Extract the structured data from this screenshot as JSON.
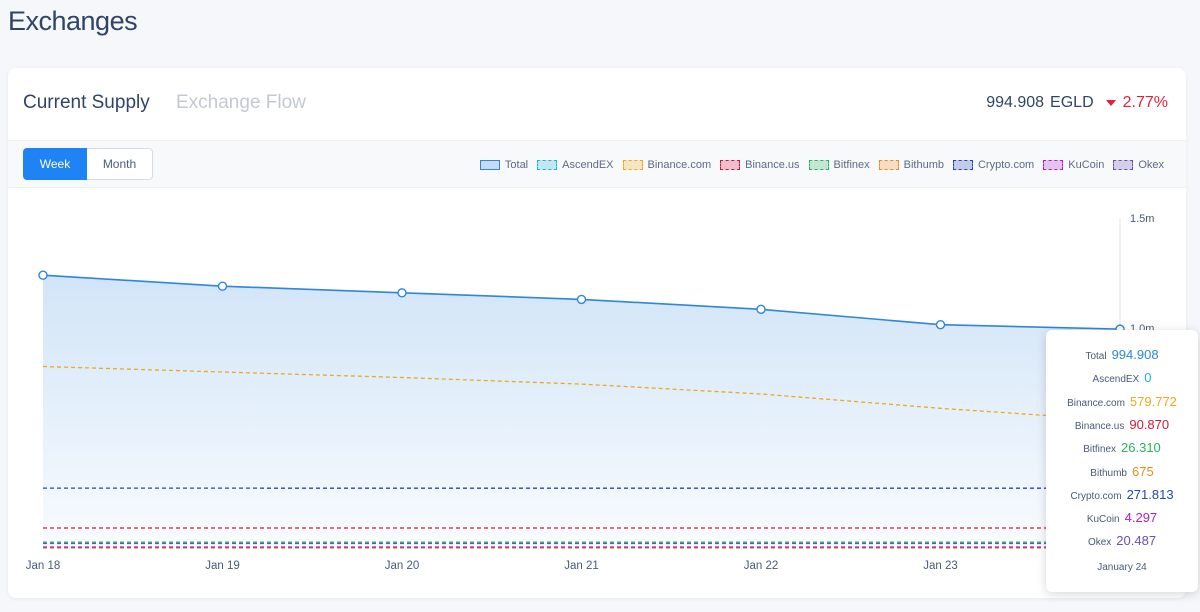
{
  "page": {
    "title": "Exchanges"
  },
  "tabs": [
    {
      "label": "Current Supply"
    },
    {
      "label": "Exchange Flow"
    }
  ],
  "summary": {
    "value": "994.908",
    "unit": "EGLD",
    "change": "2.77%"
  },
  "period_buttons": [
    {
      "label": "Week"
    },
    {
      "label": "Month"
    }
  ],
  "colors": {
    "Total": "#2e86de",
    "AscendEX": "#17b3d9",
    "Binance.com": "#f0a81e",
    "Binance.us": "#d3173d",
    "Bitfinex": "#27b360",
    "Bithumb": "#f08a1e",
    "Crypto.com": "#2048b8",
    "KuCoin": "#b01ec9",
    "Okex": "#6a50b5"
  },
  "tooltip": {
    "rows": [
      {
        "label": "Total",
        "value": "994.908"
      },
      {
        "label": "AscendEX",
        "value": "0"
      },
      {
        "label": "Binance.com",
        "value": "579.772"
      },
      {
        "label": "Binance.us",
        "value": "90.870"
      },
      {
        "label": "Bitfinex",
        "value": "26.310"
      },
      {
        "label": "Bithumb",
        "value": "675"
      },
      {
        "label": "Crypto.com",
        "value": "271.813"
      },
      {
        "label": "KuCoin",
        "value": "4.297"
      },
      {
        "label": "Okex",
        "value": "20.487"
      }
    ],
    "date": "January 24"
  },
  "chart_data": {
    "type": "area",
    "x": [
      "Jan 18",
      "Jan 19",
      "Jan 20",
      "Jan 21",
      "Jan 22",
      "Jan 23",
      "Jan 24"
    ],
    "x_tick_labels": [
      "Jan 18",
      "Jan 19",
      "Jan 20",
      "Jan 21",
      "Jan 22",
      "Jan 23"
    ],
    "y_tick_labels": [
      "1.5m",
      "1.0m"
    ],
    "y_ticks": [
      1500000,
      1000000
    ],
    "ylim": [
      0,
      1500000
    ],
    "grid": false,
    "legend": "top-right",
    "series": [
      {
        "name": "Total",
        "values": [
          1240000,
          1190000,
          1160000,
          1130000,
          1085000,
          1015000,
          994908
        ]
      },
      {
        "name": "AscendEX",
        "values": [
          0,
          0,
          0,
          0,
          0,
          0,
          0
        ]
      },
      {
        "name": "Binance.com",
        "values": [
          825000,
          800000,
          775000,
          745000,
          700000,
          635000,
          579772
        ]
      },
      {
        "name": "Binance.us",
        "values": [
          91000,
          91000,
          90900,
          90900,
          90900,
          90880,
          90870
        ]
      },
      {
        "name": "Bitfinex",
        "values": [
          26500,
          26400,
          26400,
          26350,
          26340,
          26320,
          26310
        ]
      },
      {
        "name": "Bithumb",
        "values": [
          700,
          700,
          690,
          690,
          680,
          680,
          675
        ]
      },
      {
        "name": "Crypto.com",
        "values": [
          272000,
          272000,
          271950,
          271900,
          271880,
          271850,
          271813
        ]
      },
      {
        "name": "KuCoin",
        "values": [
          4300,
          4300,
          4300,
          4300,
          4298,
          4298,
          4297
        ]
      },
      {
        "name": "Okex",
        "values": [
          20500,
          20500,
          20495,
          20490,
          20490,
          20488,
          20487
        ]
      }
    ]
  }
}
